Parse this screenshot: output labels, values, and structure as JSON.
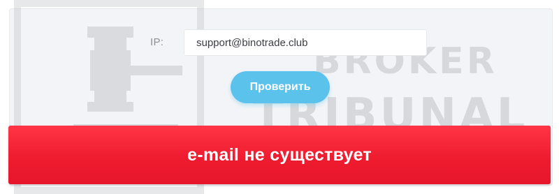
{
  "form": {
    "ip_label": "IP:",
    "email_value": "support@binotrade.club",
    "check_button_label": "Проверить"
  },
  "result": {
    "message": "e-mail не существует"
  },
  "watermark": {
    "brand_word_1": "BROKER",
    "brand_word_2": "TRIBUNAL",
    "icon": "gavel-icon"
  },
  "colors": {
    "panel_background": "#f3f4f7",
    "button_accent": "#5bc2ec",
    "error_banner": "#ef1c30",
    "text_on_accent": "#ffffff"
  }
}
